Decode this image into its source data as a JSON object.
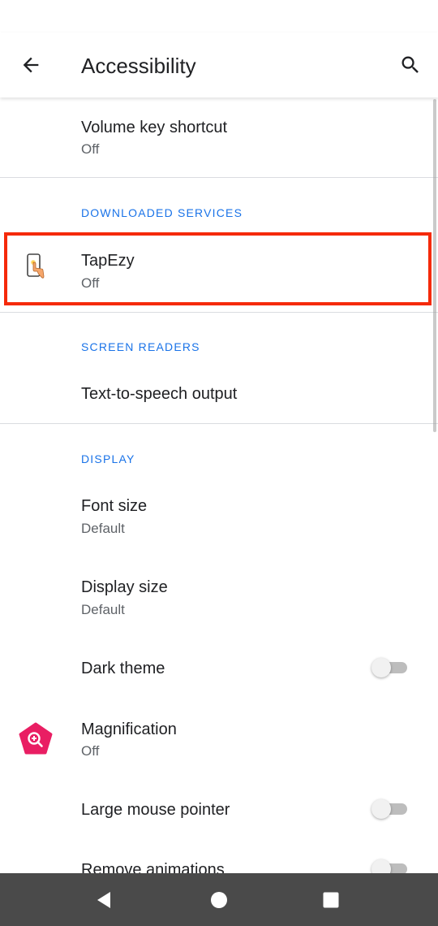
{
  "app_bar": {
    "title": "Accessibility",
    "back_icon": "arrow-left-icon",
    "search_icon": "search-icon"
  },
  "items": {
    "volume_key": {
      "label": "Volume key shortcut",
      "sub": "Off"
    },
    "downloaded_header": "DOWNLOADED SERVICES",
    "tapezy": {
      "label": "TapEzy",
      "sub": "Off",
      "icon": "phone-tap-icon"
    },
    "screen_readers_header": "SCREEN READERS",
    "tts": {
      "label": "Text-to-speech output"
    },
    "display_header": "DISPLAY",
    "font_size": {
      "label": "Font size",
      "sub": "Default"
    },
    "display_size": {
      "label": "Display size",
      "sub": "Default"
    },
    "dark_theme": {
      "label": "Dark theme",
      "enabled": false
    },
    "magnification": {
      "label": "Magnification",
      "sub": "Off",
      "icon": "magnification-icon"
    },
    "large_pointer": {
      "label": "Large mouse pointer",
      "enabled": false
    },
    "remove_animations": {
      "label": "Remove animations",
      "enabled": false
    }
  },
  "colors": {
    "accent": "#1a73e8",
    "highlight": "#f52a0a",
    "magnification_icon": "#e91e63",
    "nav_bar": "#4a4a4a"
  },
  "nav": {
    "back_icon": "nav-back-icon",
    "home_icon": "nav-home-icon",
    "recents_icon": "nav-recents-icon"
  }
}
